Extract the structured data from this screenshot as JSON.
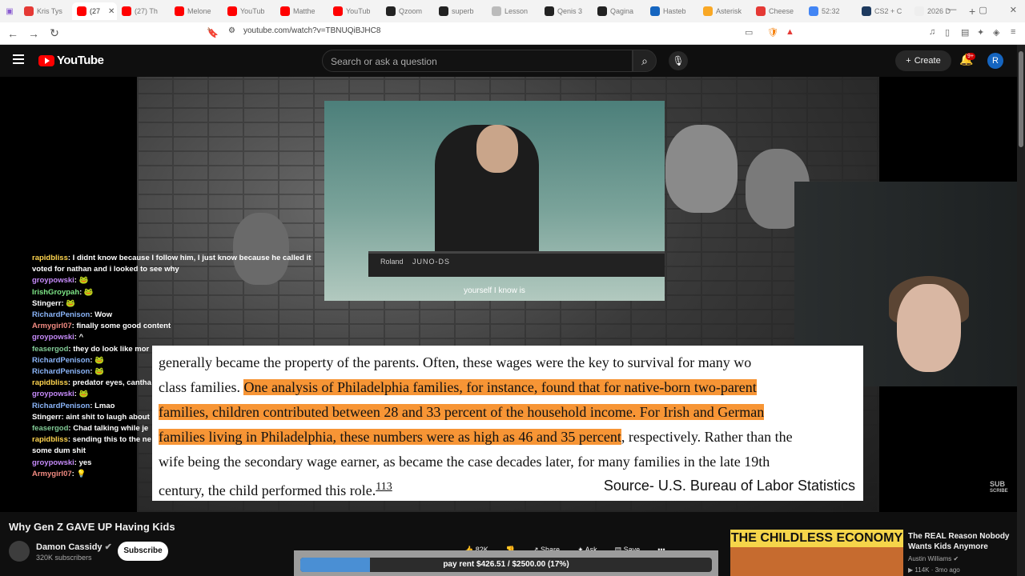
{
  "browser": {
    "tabs": [
      {
        "label": "Kris Tys",
        "color": "#e53935"
      },
      {
        "label": "(27",
        "color": "#ff0000",
        "active": true
      },
      {
        "label": "(27) Th",
        "color": "#ff0000"
      },
      {
        "label": "Melone",
        "color": "#ff0000"
      },
      {
        "label": "YouTub",
        "color": "#ff0000"
      },
      {
        "label": "Matthe",
        "color": "#ff0000"
      },
      {
        "label": "YouTub",
        "color": "#ff0000"
      },
      {
        "label": "Qzoom",
        "color": "#222222"
      },
      {
        "label": "superb",
        "color": "#222222"
      },
      {
        "label": "Lesson",
        "color": "#bbbbbb"
      },
      {
        "label": "Qenis 3",
        "color": "#222222"
      },
      {
        "label": "Qagina",
        "color": "#222222"
      },
      {
        "label": "Hasteb",
        "color": "#1565c0"
      },
      {
        "label": "Asterisk",
        "color": "#f9a825"
      },
      {
        "label": "Cheese",
        "color": "#e53935"
      },
      {
        "label": "52:32",
        "color": "#4285f4"
      },
      {
        "label": "CS2 + C",
        "color": "#1e3a5f"
      },
      {
        "label": "2026 D",
        "color": "#eeeeee"
      }
    ],
    "url": "youtube.com/watch?v=TBNUQiBJHC8"
  },
  "header": {
    "logo_text": "YouTube",
    "search_placeholder": "Search or ask a question",
    "create_label": "Create",
    "notif_badge": "9+",
    "avatar_letter": "R"
  },
  "video": {
    "inset_caption": "yourself I know is",
    "keyboard_brand": "Roland",
    "keyboard_model": "JUNO-DS",
    "text_lines": [
      {
        "plain": "generally became the property of the parents. Often, these wages were the key to survival for many wo",
        "hl": "",
        "after": ""
      },
      {
        "plain": "class families. ",
        "hl": "One analysis of Philadelphia families, for instance, found that for native-born two-parent",
        "after": ""
      },
      {
        "plain": "",
        "hl": "families, children contributed between 28 and 33 percent of the household income. For Irish and German",
        "after": ""
      },
      {
        "plain": "",
        "hl": "families living in Philadelphia, these numbers were as high as 46 and 35 percent",
        "after": ", respectively. Rather than the"
      },
      {
        "plain": "wife being the secondary wage earner, as became the case decades later, for many families in the late 19th",
        "hl": "",
        "after": ""
      },
      {
        "plain": "century, the child performed this role.",
        "hl": "",
        "after": ""
      }
    ],
    "footnote": "113",
    "source": "Source- U.S. Bureau of Labor Statistics",
    "sub_watermark_1": "SUB",
    "sub_watermark_2": "SCRIBE"
  },
  "chat": [
    {
      "user": "rapidbliss",
      "color": "#ffd54f",
      "text": ": I didnt know because I follow him, I just know because he called it"
    },
    {
      "user": "",
      "color": "#ffffff",
      "text": "voted for nathan and i looked to see why"
    },
    {
      "user": "groypowski",
      "color": "#c58af9",
      "text": ": 🐸"
    },
    {
      "user": "IrishGroypah",
      "color": "#7ee787",
      "text": ": 🐸"
    },
    {
      "user": "Stingerr",
      "color": "#ffffff",
      "text": ": 🐸"
    },
    {
      "user": "RichardPenison",
      "color": "#8ab4f8",
      "text": ": Wow"
    },
    {
      "user": "Armygirl07",
      "color": "#f28b82",
      "text": ": finally some good content"
    },
    {
      "user": "groypowski",
      "color": "#c58af9",
      "text": ": ^"
    },
    {
      "user": "feasergod",
      "color": "#81c995",
      "text": ": they do look like mor"
    },
    {
      "user": "RichardPenison",
      "color": "#8ab4f8",
      "text": ": 🐸"
    },
    {
      "user": "RichardPenison",
      "color": "#8ab4f8",
      "text": ": 🐸"
    },
    {
      "user": "rapidbliss",
      "color": "#ffd54f",
      "text": ": predator eyes, cantha"
    },
    {
      "user": "groypowski",
      "color": "#c58af9",
      "text": ": 🐸"
    },
    {
      "user": "RichardPenison",
      "color": "#8ab4f8",
      "text": ": Lmao"
    },
    {
      "user": "Stingerr",
      "color": "#ffffff",
      "text": ": aint shit to laugh about"
    },
    {
      "user": "feasergod",
      "color": "#81c995",
      "text": ": Chad talking while je"
    },
    {
      "user": "rapidbliss",
      "color": "#ffd54f",
      "text": ": sending this to the ne"
    },
    {
      "user": "",
      "color": "#ffffff",
      "text": "some dum shit"
    },
    {
      "user": "groypowski",
      "color": "#c58af9",
      "text": ": yes"
    },
    {
      "user": "Armygirl07",
      "color": "#f28b82",
      "text": ": 💡"
    }
  ],
  "below": {
    "title": "Why Gen Z GAVE UP Having Kids",
    "channel": "Damon Cassidy",
    "subscribers": "320K subscribers",
    "subscribe": "Subscribe",
    "likes": "82K",
    "share": "Share",
    "ask": "Ask",
    "save": "Save",
    "donation_text": "pay rent $426.51 / $2500.00 (17%)",
    "donation_fraction": 0.17
  },
  "recommended": {
    "thumb_text": "THE CHILDLESS ECONOMY",
    "title": "The REAL Reason Nobody Wants Kids Anymore",
    "channel": "Austin Williams",
    "views": "114K",
    "age": "3mo ago"
  }
}
